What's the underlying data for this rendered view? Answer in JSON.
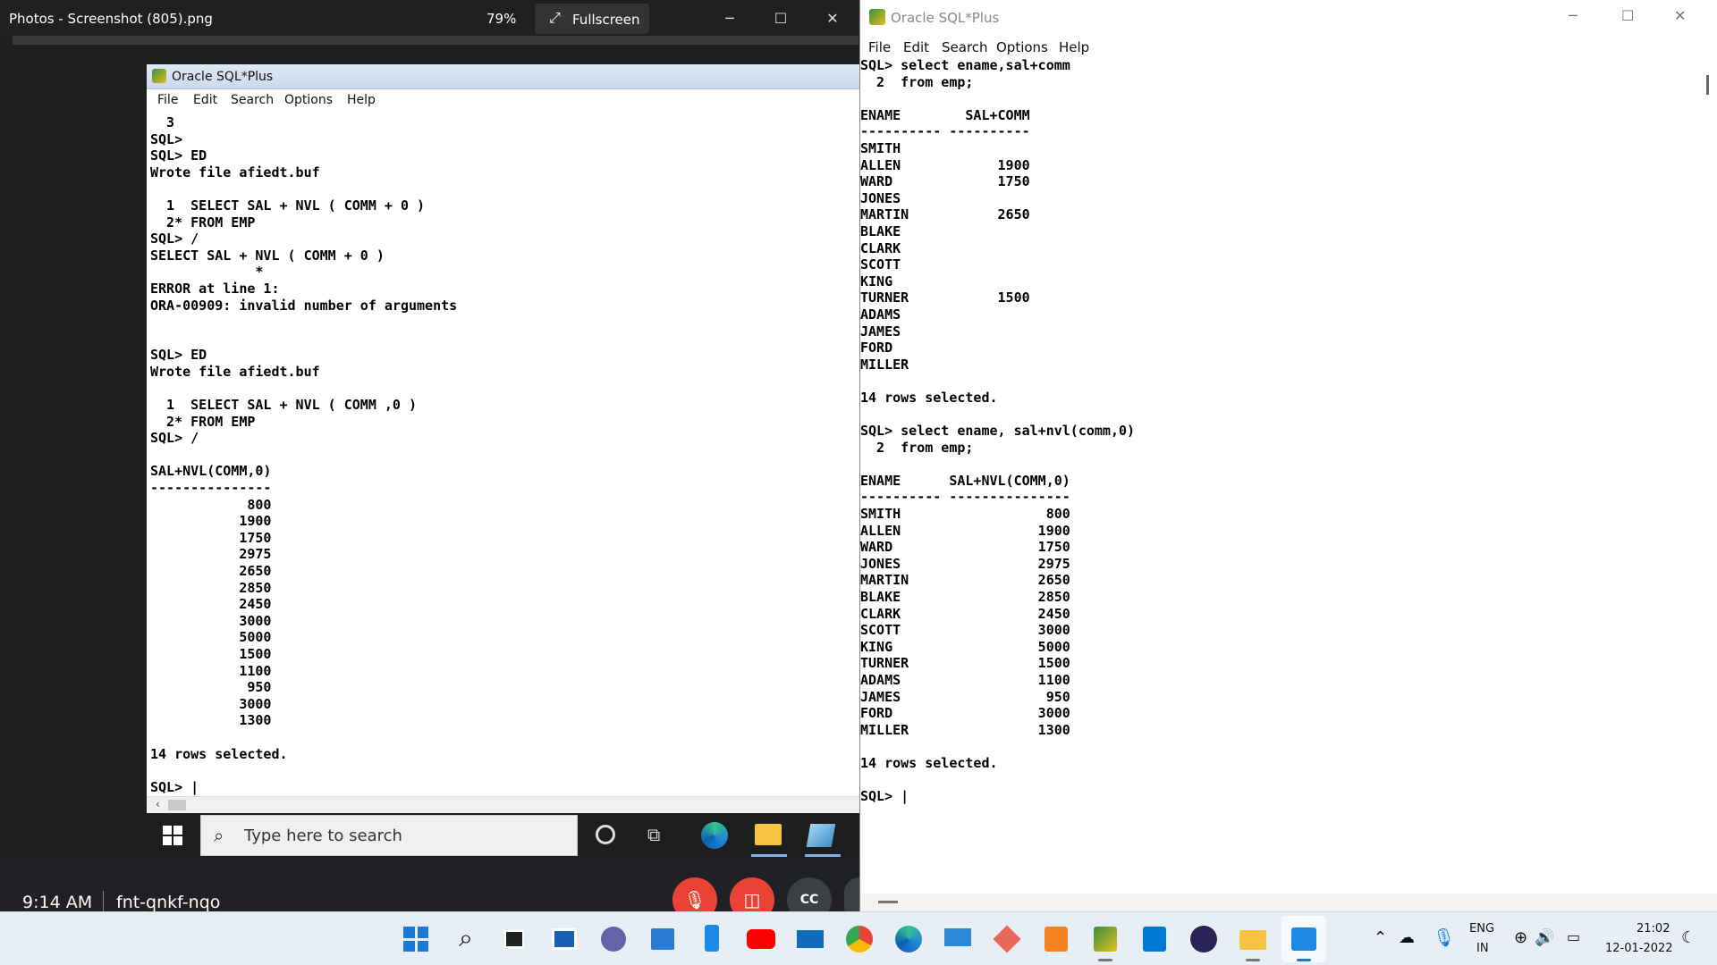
{
  "photos": {
    "title": "Photos - Screenshot (805).png",
    "zoom": "79%",
    "fullscreen_label": "Fullscreen",
    "meet_time": "9:14 AM",
    "meet_code": "fnt-qnkf-nqo"
  },
  "inner_window": {
    "title": "Oracle SQL*Plus",
    "menu": [
      "File",
      "Edit",
      "Search",
      "Options",
      "Help"
    ],
    "console": "  3\nSQL>\nSQL> ED\nWrote file afiedt.buf\n\n  1  SELECT SAL + NVL ( COMM + 0 )\n  2* FROM EMP\nSQL> /\nSELECT SAL + NVL ( COMM + 0 )\n             *\nERROR at line 1:\nORA-00909: invalid number of arguments\n\n\nSQL> ED\nWrote file afiedt.buf\n\n  1  SELECT SAL + NVL ( COMM ,0 )\n  2* FROM EMP\nSQL> /\n\nSAL+NVL(COMM,0)\n---------------\n            800\n           1900\n           1750\n           2975\n           2650\n           2850\n           2450\n           3000\n           5000\n           1500\n           1100\n            950\n           3000\n           1300\n\n14 rows selected.\n\nSQL> |"
  },
  "inner_taskbar": {
    "search_placeholder": "Type here to search"
  },
  "sql_window": {
    "title": "Oracle SQL*Plus",
    "menu": [
      "File",
      "Edit",
      "Search",
      "Options",
      "Help"
    ],
    "console": "SQL> select ename,sal+comm\n  2  from emp;\n\nENAME        SAL+COMM\n---------- ----------\nSMITH\nALLEN            1900\nWARD             1750\nJONES\nMARTIN           2650\nBLAKE\nCLARK\nSCOTT\nKING\nTURNER           1500\nADAMS\nJAMES\nFORD\nMILLER\n\n14 rows selected.\n\nSQL> select ename, sal+nvl(comm,0)\n  2  from emp;\n\nENAME      SAL+NVL(COMM,0)\n---------- ---------------\nSMITH                  800\nALLEN                 1900\nWARD                  1750\nJONES                 2975\nMARTIN                2650\nBLAKE                 2850\nCLARK                 2450\nSCOTT                 3000\nKING                  5000\nTURNER                1500\nADAMS                 1100\nJAMES                  950\nFORD                  3000\nMILLER                1300\n\n14 rows selected.\n\nSQL> |"
  },
  "taskbar": {
    "lang_top": "ENG",
    "lang_bottom": "IN",
    "time": "21:02",
    "date": "12-01-2022"
  }
}
